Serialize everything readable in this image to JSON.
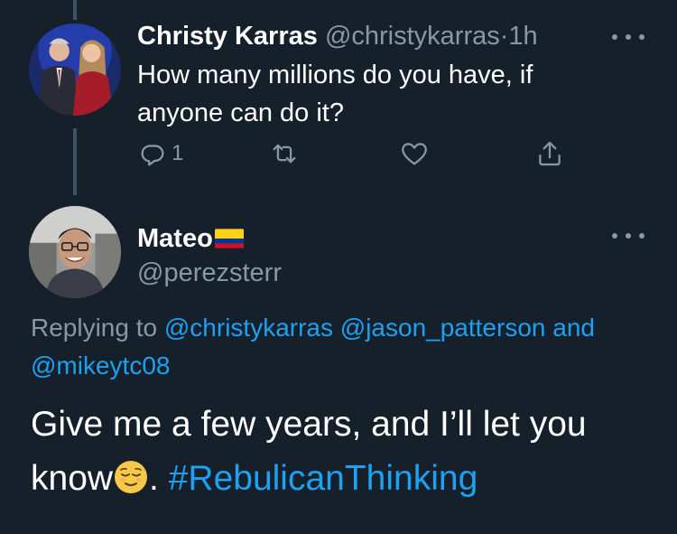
{
  "parent_tweet": {
    "display_name": "Christy Karras",
    "handle": "@christykarras",
    "separator": "·",
    "time": "1h",
    "text": "How many millions do you have, if anyone can do it?",
    "reply_count": "1",
    "avatar_icon": "avatar-photo-two-people"
  },
  "reply_tweet": {
    "display_name": "Mateo",
    "flag_icon": "colombia-flag-icon",
    "handle": "@perezsterr",
    "replying_prefix": "Replying to",
    "mentions": [
      "@christykarras",
      "@jason_patterson",
      "@mikeytc08"
    ],
    "mention_joiner": "and",
    "text_part1": "Give me a few years, and I’ll let you know",
    "emoji_icon": "relieved-face-emoji",
    "text_part2": ". ",
    "hashtag": "#RebulicanThinking",
    "avatar_icon": "avatar-photo-man-glasses"
  },
  "icons": {
    "reply": "reply-icon",
    "retweet": "retweet-icon",
    "like": "heart-icon",
    "share": "share-icon",
    "more": "more-dots-icon"
  },
  "colors": {
    "background": "#15202b",
    "text": "#ffffff",
    "muted": "#8899a6",
    "accent": "#1da1f2",
    "thread_line": "#3d5466"
  }
}
